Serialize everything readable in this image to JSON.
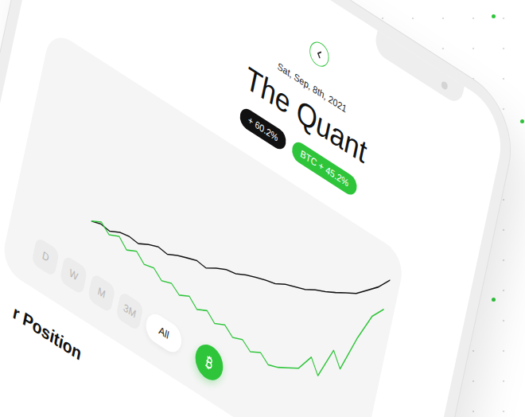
{
  "header": {
    "date": "Sat, Sep, 8th, 2021",
    "title": "The Quant"
  },
  "badges": [
    {
      "label": "+ 60.2%",
      "color": "#111111"
    },
    {
      "label": "BTC + 45.2%",
      "color": "#2fc53b"
    }
  ],
  "chart": {
    "series": [
      {
        "color": "#111111",
        "values": [
          0,
          1.5,
          0.8,
          3.2,
          4.1,
          3.5,
          6.0,
          7.8,
          7.1,
          9.5,
          11.2,
          12.8,
          12.1,
          15.0,
          17.3,
          18.2,
          20.6,
          22.4,
          23.9,
          25.1,
          27.8,
          29.5,
          31.2,
          34.0,
          36.1,
          38.7,
          41.5,
          44.2,
          48.9,
          53.6,
          60.2
        ]
      },
      {
        "color": "#2fc53b",
        "values": [
          0,
          2.5,
          -1.0,
          1.2,
          -2.8,
          -0.5,
          -4.2,
          -3.0,
          -6.5,
          -4.8,
          -7.9,
          -5.5,
          -9.2,
          -6.8,
          -10.4,
          -8.1,
          -11.5,
          -9.6,
          -12.8,
          -10.2,
          -13.5,
          -11.8,
          -9.0,
          -6.2,
          2.5,
          -4.0,
          12.0,
          5.5,
          24.0,
          38.5,
          45.2
        ]
      }
    ]
  },
  "periods": [
    {
      "label": "D",
      "selected": false
    },
    {
      "label": "W",
      "selected": false
    },
    {
      "label": "M",
      "selected": false
    },
    {
      "label": "3M",
      "selected": false
    },
    {
      "label": "All",
      "selected": true
    }
  ],
  "section": {
    "title": "r Position"
  }
}
